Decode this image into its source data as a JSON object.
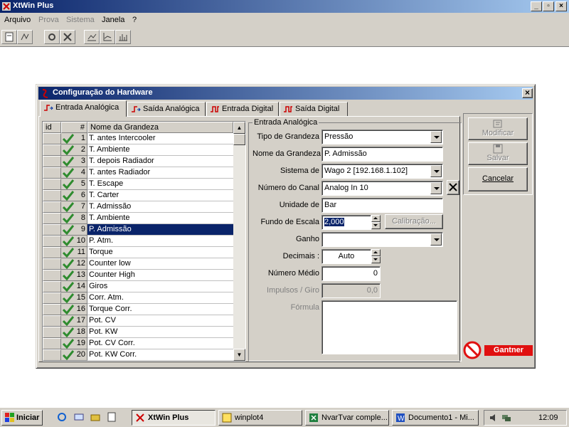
{
  "app": {
    "title": "XtWin Plus"
  },
  "menu": [
    {
      "label": "Arquivo",
      "enabled": true
    },
    {
      "label": "Prova",
      "enabled": false
    },
    {
      "label": "Sistema",
      "enabled": false
    },
    {
      "label": "Janela",
      "enabled": true
    },
    {
      "label": "?",
      "enabled": true
    }
  ],
  "dialog": {
    "title": "Configuração do Hardware",
    "close_glyph": "×",
    "tabs": [
      "Entrada Analógica",
      "Saída Analógica",
      "Entrada Digital",
      "Saída Digital"
    ],
    "active_tab": 0
  },
  "grid": {
    "headers": [
      "id",
      "#",
      "Nome da Grandeza"
    ],
    "rows": [
      {
        "n": "1",
        "name": "T. antes Intercooler"
      },
      {
        "n": "2",
        "name": "T. Ambiente"
      },
      {
        "n": "3",
        "name": "T. depois Radiador"
      },
      {
        "n": "4",
        "name": "T. antes Radiador"
      },
      {
        "n": "5",
        "name": "T. Escape"
      },
      {
        "n": "6",
        "name": "T. Carter"
      },
      {
        "n": "7",
        "name": "T. Admissão"
      },
      {
        "n": "8",
        "name": "T. Ambiente"
      },
      {
        "n": "9",
        "name": "P. Admissão"
      },
      {
        "n": "10",
        "name": "P. Atm."
      },
      {
        "n": "11",
        "name": "Torque"
      },
      {
        "n": "12",
        "name": "Counter low"
      },
      {
        "n": "13",
        "name": "Counter High"
      },
      {
        "n": "14",
        "name": "Giros"
      },
      {
        "n": "15",
        "name": "Corr. Atm."
      },
      {
        "n": "16",
        "name": "Torque Corr."
      },
      {
        "n": "17",
        "name": "Pot. CV"
      },
      {
        "n": "18",
        "name": "Pot. KW"
      },
      {
        "n": "19",
        "name": "Pot. CV Corr."
      },
      {
        "n": "20",
        "name": "Pot. KW Corr."
      }
    ],
    "selected_index": 8
  },
  "form": {
    "group_title": "Entrada Analógica",
    "tipo_label": "Tipo de Grandeza",
    "tipo_value": "Pressão",
    "nome_label": "Nome da Grandeza",
    "nome_value": "P. Admissão",
    "sistema_label": "Sistema de",
    "sistema_value": "Wago 2 [192.168.1.102]",
    "canal_label": "Número do Canal",
    "canal_value": "Analog In 10",
    "unidade_label": "Unidade de",
    "unidade_value": "Bar",
    "fundo_label": "Fundo de Escala",
    "fundo_value": "2,000",
    "calibracao_label": "Calibração...",
    "ganho_label": "Ganho",
    "ganho_value": "",
    "decimais_label": "Decimais :",
    "decimais_value": "Auto",
    "medio_label": "Número Médio",
    "medio_value": "0",
    "impulsos_label": "Impulsos / Giro",
    "impulsos_value": "0,0",
    "formula_label": "Fórmula"
  },
  "actions": {
    "modificar": "Modificar",
    "salvar": "Salvar",
    "cancelar": "Cancelar"
  },
  "brand": {
    "logo_text": "Gantner"
  },
  "taskbar": {
    "start": "Iniciar",
    "tasks": [
      "XtWin Plus",
      "winplot4",
      "NvarTvar comple...",
      "Documento1 - Mi..."
    ],
    "clock": "12:09"
  },
  "colors": {
    "title_blue": "#0a246a",
    "selection": "#0a246a",
    "check_green": "#2e8b2e",
    "brand_red": "#e01010"
  }
}
